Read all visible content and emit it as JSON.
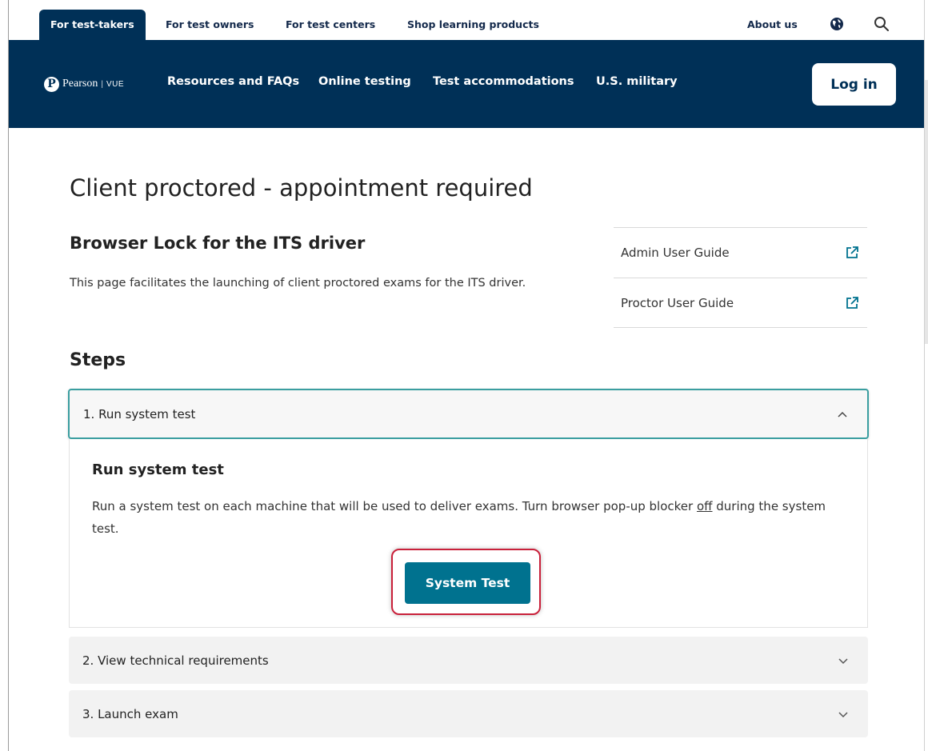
{
  "utility_bar": {
    "tabs": [
      {
        "label": "For test-takers",
        "active": true
      },
      {
        "label": "For test owners",
        "active": false
      },
      {
        "label": "For test centers",
        "active": false
      },
      {
        "label": "Shop learning products",
        "active": false
      }
    ],
    "about_label": "About us",
    "icons": [
      "globe-icon",
      "search-icon"
    ]
  },
  "main_nav": {
    "logo": {
      "brand": "Pearson",
      "separator": "|",
      "product": "VUE"
    },
    "links": [
      "Resources and FAQs",
      "Online testing",
      "Test accommodations",
      "U.S. military"
    ],
    "login_label": "Log in"
  },
  "content": {
    "page_title": "Client proctored - appointment required",
    "subtitle": "Browser Lock for the ITS driver",
    "description": "This page facilitates the launching of client proctored exams for the ITS driver.",
    "guides": [
      {
        "label": "Admin User Guide",
        "icon": "external-link-icon"
      },
      {
        "label": "Proctor User Guide",
        "icon": "external-link-icon"
      }
    ],
    "steps_title": "Steps",
    "steps": [
      {
        "label": "1. Run system test",
        "expanded": true,
        "body_title": "Run system test",
        "body_text_before": "Run a system test on each machine that will be used to deliver exams. Turn browser pop-up blocker ",
        "body_text_emphasis": "off",
        "body_text_after": " during the system test.",
        "button_label": "System Test"
      },
      {
        "label": "2. View technical requirements",
        "expanded": false
      },
      {
        "label": "3. Launch exam",
        "expanded": false
      }
    ]
  },
  "colors": {
    "navy": "#003057",
    "teal_button": "#00728f",
    "accordion_border": "#3a9ea0",
    "highlight_red": "#c9203a"
  }
}
